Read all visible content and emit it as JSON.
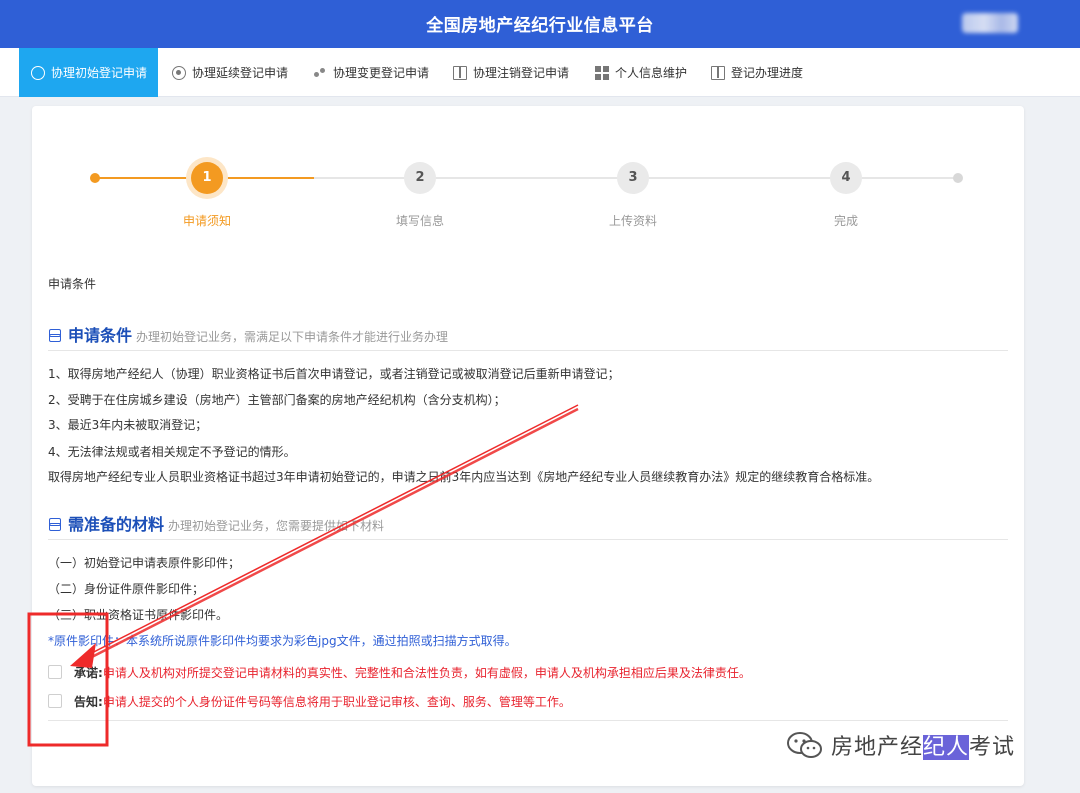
{
  "header": {
    "title": "全国房地产经纪行业信息平台"
  },
  "nav": {
    "items": [
      {
        "label": "协理初始登记申请",
        "icon": "clock-icon"
      },
      {
        "label": "协理延续登记申请",
        "icon": "target-icon"
      },
      {
        "label": "协理变更登记申请",
        "icon": "dots-icon"
      },
      {
        "label": "协理注销登记申请",
        "icon": "book-icon"
      },
      {
        "label": "个人信息维护",
        "icon": "grid-icon"
      },
      {
        "label": "登记办理进度",
        "icon": "book-icon"
      }
    ]
  },
  "steps": [
    {
      "num": "1",
      "label": "申请须知"
    },
    {
      "num": "2",
      "label": "填写信息"
    },
    {
      "num": "3",
      "label": "上传资料"
    },
    {
      "num": "4",
      "label": "完成"
    }
  ],
  "content": {
    "page_label": "申请条件",
    "conditions": {
      "title": "申请条件",
      "subtitle": "办理初始登记业务，需满足以下申请条件才能进行业务办理",
      "items": [
        "1、取得房地产经纪人（协理）职业资格证书后首次申请登记，或者注销登记或被取消登记后重新申请登记；",
        "2、受聘于在住房城乡建设（房地产）主管部门备案的房地产经纪机构（含分支机构）；",
        "3、最近3年内未被取消登记；",
        "4、无法律法规或者相关规定不予登记的情形。",
        "取得房地产经纪专业人员职业资格证书超过3年申请初始登记的，申请之日前3年内应当达到《房地产经纪专业人员继续教育办法》规定的继续教育合格标准。"
      ]
    },
    "materials": {
      "title": "需准备的材料",
      "subtitle": "办理初始登记业务，您需要提供如下材料",
      "items": [
        "（一）初始登记申请表原件影印件；",
        "（二）身份证件原件影印件；",
        "（三）职业资格证书原件影印件。"
      ],
      "note": "*原件影印件：本系统所说原件影印件均要求为彩色jpg文件，通过拍照或扫描方式取得。"
    },
    "agreements": [
      {
        "key": "承诺:",
        "text": "申请人及机构对所提交登记申请材料的真实性、完整性和合法性负责，如有虚假，申请人及机构承担相应后果及法律责任。"
      },
      {
        "key": "告知:",
        "text": "申请人提交的个人身份证件号码等信息将用于职业登记审核、查询、服务、管理等工作。"
      }
    ]
  },
  "watermark": {
    "text_before": "房地产经",
    "text_highlight": "纪人",
    "text_after": "考试"
  },
  "colors": {
    "header": "#2f5fd6",
    "nav_active": "#1ea7f0",
    "step_active": "#f39a21",
    "warning_red": "#e8232e",
    "annotation_red": "#ee2a2a"
  }
}
